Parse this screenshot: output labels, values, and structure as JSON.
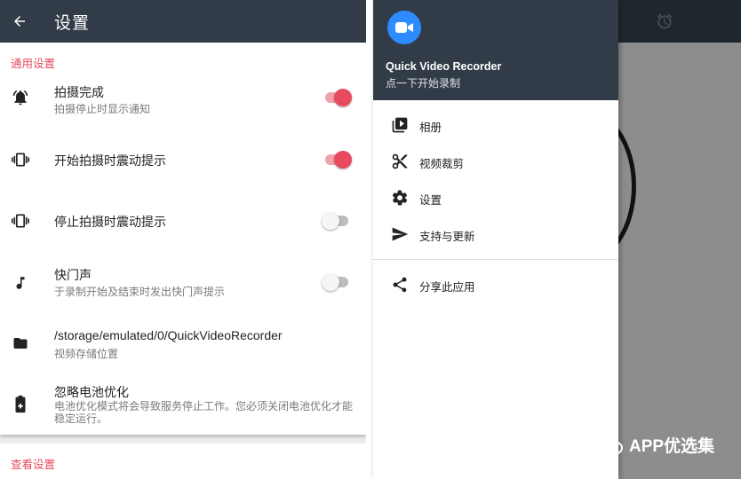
{
  "settings": {
    "title": "设置",
    "section_general": "通用设置",
    "section_view": "查看设置",
    "items": [
      {
        "title": "拍摄完成",
        "subtitle": "拍摄停止时显示通知",
        "toggle": "on",
        "icon": "bell-ring-icon"
      },
      {
        "title": "开始拍摄时震动提示",
        "subtitle": "",
        "toggle": "on",
        "icon": "vibrate-icon"
      },
      {
        "title": "停止拍摄时震动提示",
        "subtitle": "",
        "toggle": "off",
        "icon": "vibrate-icon"
      },
      {
        "title": "快门声",
        "subtitle": "于录制开始及结束时发出快门声提示",
        "toggle": "off",
        "icon": "music-note-icon"
      },
      {
        "title": "/storage/emulated/0/QuickVideoRecorder",
        "subtitle": "视频存储位置",
        "icon": "folder-icon"
      },
      {
        "title": "忽略电池优化",
        "subtitle": "电池优化模式将会导致服务停止工作。您必须关闭电池优化才能稳定运行。",
        "icon": "battery-plus-icon"
      }
    ]
  },
  "drawer": {
    "app_name": "Quick Video Recorder",
    "app_subtitle": "点一下开始录制",
    "menu": [
      {
        "label": "相册",
        "icon": "video-library-icon"
      },
      {
        "label": "视频裁剪",
        "icon": "scissors-icon"
      },
      {
        "label": "设置",
        "icon": "gear-icon"
      },
      {
        "label": "支持与更新",
        "icon": "send-icon"
      },
      {
        "label": "分享此应用",
        "icon": "share-icon"
      }
    ]
  },
  "watermark": {
    "text": "APP优选集"
  },
  "colors": {
    "accent": "#e84a5f",
    "appbar": "#323c48",
    "logo": "#2d8cff"
  }
}
